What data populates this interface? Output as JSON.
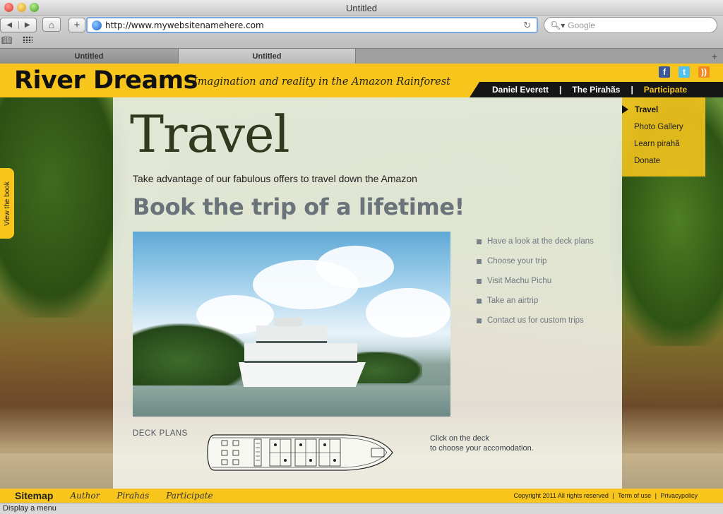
{
  "browser": {
    "window_title": "Untitled",
    "url": "http://www.mywebsitenamehere.com",
    "search_placeholder": "Google",
    "tabs": [
      {
        "label": "Untitled"
      },
      {
        "label": "Untitled"
      }
    ],
    "status_text": "Display a menu"
  },
  "site": {
    "logo": "River Dreams",
    "tagline": "Imagination and reality in the Amazon Rainforest",
    "social": {
      "facebook": "f",
      "twitter": "t",
      "rss": "))"
    },
    "nav": {
      "items": [
        "Daniel Everett",
        "The Pirahãs",
        "Participate"
      ],
      "separator": "|"
    },
    "dropdown": [
      "Travel",
      "Photo Gallery",
      "Learn pirahã",
      "Donate"
    ],
    "side_tab": "View the book",
    "page": {
      "title": "Travel",
      "intro": "Take advantage of our fabulous offers to travel down the Amazon",
      "headline": "Book the trip of a lifetime!",
      "links": [
        "Have a look at the deck plans",
        "Choose your trip",
        "Visit Machu Pichu",
        "Take an airtrip",
        "Contact us for custom trips"
      ],
      "deck_label": "DECK PLANS",
      "deck_hint_line1": "Click on the deck",
      "deck_hint_line2": "to choose your accomodation."
    },
    "footer": {
      "sitemap": "Sitemap",
      "links": [
        "Author",
        "Pirahas",
        "Participate"
      ],
      "copyright": "Copyright 2011 All rights reserved",
      "terms": "Term of use",
      "privacy": "Privacypolicy",
      "separator": "|"
    }
  },
  "colors": {
    "brand_yellow": "#f7c51c",
    "nav_black": "#161616"
  }
}
